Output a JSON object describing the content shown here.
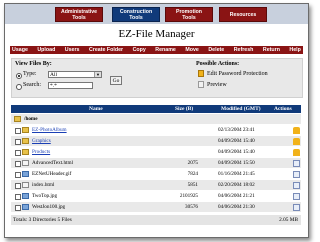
{
  "nav": {
    "tabs": [
      {
        "line1": "Administrative",
        "line2": "Tools"
      },
      {
        "line1": "Construction",
        "line2": "Tools"
      },
      {
        "line1": "Promotion",
        "line2": "Tools"
      },
      {
        "line1": "Resources",
        "line2": ""
      }
    ],
    "active_index": 1
  },
  "page_title": "EZ-File Manager",
  "toolbar": [
    "Usage",
    "Upload",
    "Users",
    "Create Folder",
    "Copy",
    "Rename",
    "Move",
    "Delete",
    "Refresh",
    "Return",
    "Help"
  ],
  "view_files": {
    "heading": "View Files By:",
    "type_label": "Type:",
    "type_value": "All",
    "search_label": "Search:",
    "search_value": "*.*",
    "go_label": "Go"
  },
  "possible_actions": {
    "heading": "Possible Actions:",
    "items": [
      "Edit Password Protection",
      "Preview"
    ]
  },
  "table": {
    "headers": {
      "name": "Name",
      "size": "Size (B)",
      "modified": "Modified (GMT)",
      "actions": "Actions"
    },
    "current_path": "/home",
    "rows": [
      {
        "name": "EZ-PhotoAlbum",
        "size": "",
        "modified": "02/13/2004 23:41",
        "type": "folder",
        "action": "lock-icon"
      },
      {
        "name": "Graphics",
        "size": "",
        "modified": "04/09/2004 15:40",
        "type": "folder",
        "action": "lock-icon"
      },
      {
        "name": "Products",
        "size": "",
        "modified": "04/09/2004 15:40",
        "type": "folder",
        "action": "lock-icon"
      },
      {
        "name": "AdvancedText.html",
        "size": "2075",
        "modified": "04/09/2004 15:50",
        "type": "file",
        "action": "preview-icon"
      },
      {
        "name": "EZNetUHeader.gif",
        "size": "7824",
        "modified": "01/16/2004 21:45",
        "type": "image",
        "action": "preview-icon"
      },
      {
        "name": "index.html",
        "size": "5851",
        "modified": "02/20/2004 18:02",
        "type": "file",
        "action": "preview-icon"
      },
      {
        "name": "TwoTop.jpg",
        "size": "2101925",
        "modified": "04/06/2004 21:21",
        "type": "image",
        "action": "preview-icon"
      },
      {
        "name": "WestJon100.jpg",
        "size": "30576",
        "modified": "04/06/2004 21:30",
        "type": "image",
        "action": "preview-icon"
      }
    ],
    "footer_left": "Totals: 3 Directories  5 Files",
    "footer_right": "2.05 MB"
  }
}
